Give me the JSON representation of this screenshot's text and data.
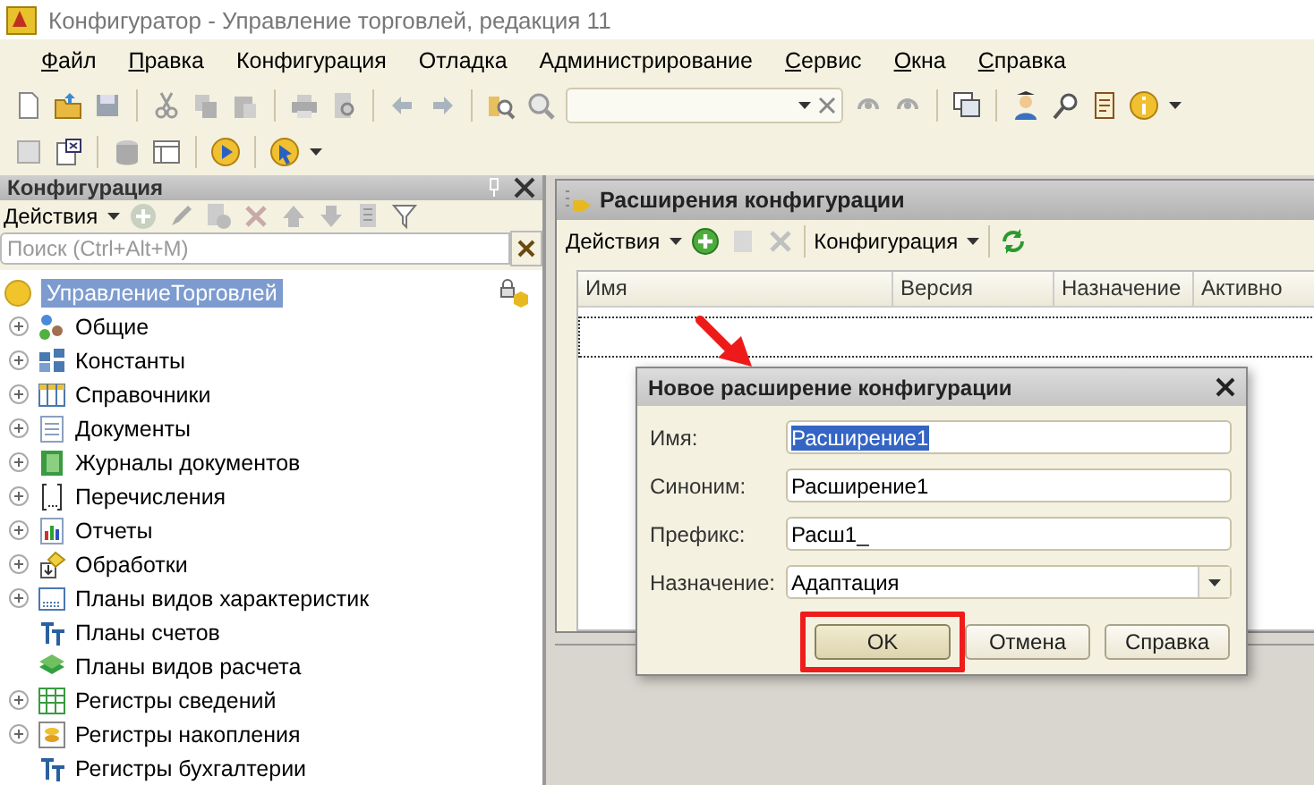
{
  "window": {
    "title": "Конфигуратор - Управление торговлей, редакция 11"
  },
  "menu": [
    {
      "label": "Файл",
      "mnemonic": true
    },
    {
      "label": "Правка",
      "mnemonic": true
    },
    {
      "label": "Конфигурация",
      "mnemonic": false
    },
    {
      "label": "Отладка",
      "mnemonic": false
    },
    {
      "label": "Администрирование",
      "mnemonic": false
    },
    {
      "label": "Сервис",
      "mnemonic": true
    },
    {
      "label": "Окна",
      "mnemonic": true
    },
    {
      "label": "Справка",
      "mnemonic": true
    }
  ],
  "config_panel": {
    "title": "Конфигурация",
    "actions_label": "Действия",
    "search": {
      "placeholder": "Поиск (Ctrl+Alt+M)"
    },
    "tree": {
      "label": "УправлениеТорговлей",
      "selected": true,
      "children": [
        {
          "label": "Общие",
          "kind": "common",
          "has_children": true
        },
        {
          "label": "Константы",
          "kind": "constants",
          "has_children": true
        },
        {
          "label": "Справочники",
          "kind": "catalogs",
          "has_children": true
        },
        {
          "label": "Документы",
          "kind": "documents",
          "has_children": true
        },
        {
          "label": "Журналы документов",
          "kind": "journals",
          "has_children": true
        },
        {
          "label": "Перечисления",
          "kind": "enums",
          "has_children": true
        },
        {
          "label": "Отчеты",
          "kind": "reports",
          "has_children": true
        },
        {
          "label": "Обработки",
          "kind": "processing",
          "has_children": true
        },
        {
          "label": "Планы видов характеристик",
          "kind": "charts",
          "has_children": true
        },
        {
          "label": "Планы счетов",
          "kind": "accounts",
          "has_children": false
        },
        {
          "label": "Планы видов расчета",
          "kind": "calc",
          "has_children": false
        },
        {
          "label": "Регистры сведений",
          "kind": "info_registers",
          "has_children": true
        },
        {
          "label": "Регистры накопления",
          "kind": "accum_registers",
          "has_children": true
        },
        {
          "label": "Регистры бухгалтерии",
          "kind": "accounts",
          "has_children": false
        }
      ]
    }
  },
  "extensions_window": {
    "title": "Расширения конфигурации",
    "actions_label": "Действия",
    "configuration_label": "Конфигурация",
    "table": {
      "columns": [
        "Имя",
        "Версия",
        "Назначение",
        "Активно"
      ]
    }
  },
  "dialog": {
    "title": "Новое расширение конфигурации",
    "fields": [
      {
        "label": "Имя:",
        "value": "Расширение1",
        "kind": "text",
        "selected": true
      },
      {
        "label": "Синоним:",
        "value": "Расширение1",
        "kind": "text",
        "selected": false
      },
      {
        "label": "Префикс:",
        "value": "Расш1_",
        "kind": "text",
        "selected": false
      },
      {
        "label": "Назначение:",
        "value": "Адаптация",
        "kind": "dropdown",
        "selected": false
      }
    ],
    "buttons": [
      {
        "label": "OK",
        "default": true,
        "highlighted": true
      },
      {
        "label": "Отмена",
        "default": false,
        "highlighted": false
      },
      {
        "label": "Справка",
        "default": false,
        "highlighted": false
      }
    ]
  }
}
